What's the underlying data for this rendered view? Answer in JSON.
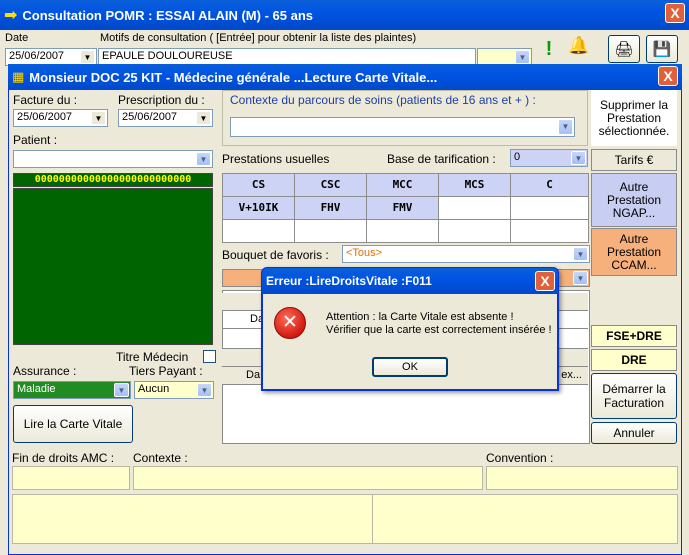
{
  "main_window": {
    "title": "Consultation POMR : ESSAI ALAIN (M) -  65 ans",
    "close_label": "X",
    "date_label": "Date",
    "date_value": "25/06/2007",
    "motifs_label": "Motifs de consultation ( [Entrée]  pour obtenir la liste des plaintes)",
    "motif_value": "EPAULE DOULOUREUSE"
  },
  "dialog": {
    "title": "Monsieur DOC 25 KIT - Médecine générale ...Lecture Carte Vitale...",
    "close_label": "X",
    "facture_label": "Facture du :",
    "facture_value": "25/06/2007",
    "prescription_label": "Prescription du :",
    "prescription_value": "25/06/2007",
    "patient_label": "Patient :",
    "card_number": "00000000000000000000000000",
    "titre_medecin_label": "Titre Médecin",
    "assurance_label": "Assurance :",
    "assurance_value": "Maladie",
    "tiers_payant_label": "Tiers Payant :",
    "tiers_payant_value": "Aucun",
    "lire_carte_label": "Lire la Carte Vitale",
    "contexte_parcours_label": "Contexte du parcours de soins (patients de 16 ans et + ) :",
    "prestations_label": "Prestations usuelles",
    "base_tarif_label": "Base de tarification :",
    "base_tarif_value": "0",
    "prestations": [
      "CS",
      "CSC",
      "MCC",
      "MCS",
      "C",
      "V+10IK",
      "FHV",
      "FMV"
    ],
    "bouquet_label": "Bouquet de favoris :",
    "bouquet_value": "<Tous>",
    "table_partial_1": "Da",
    "table_partial_2": "Da",
    "table_partial_3": "ex...",
    "fin_droits_label": "Fin de droits AMC :",
    "contexte_label": "Contexte :",
    "convention_label": "Convention :",
    "side": {
      "supprimer": "Supprimer la Prestation sélectionnée.",
      "tarifs": "Tarifs €",
      "autre_ngap": "Autre Prestation NGAP...",
      "autre_ccam": "Autre Prestation CCAM...",
      "fse_dre": "FSE+DRE",
      "dre": "DRE",
      "demarrer": "Démarrer la Facturation",
      "annuler": "Annuler"
    }
  },
  "error": {
    "title": "Erreur :LireDroitsVitale :F011",
    "close_label": "X",
    "line1": "Attention : la Carte Vitale est absente !",
    "line2": "Vérifier que la carte est correctement insérée !",
    "ok_label": "OK"
  },
  "colors": {
    "xp_blue": "#0054e3",
    "card_green": "#006400",
    "grid_active": "#cdd3f5",
    "ngap_blue": "#c8cdf2",
    "ccam_orange": "#f5b07b",
    "yellow": "#ffffcc"
  }
}
